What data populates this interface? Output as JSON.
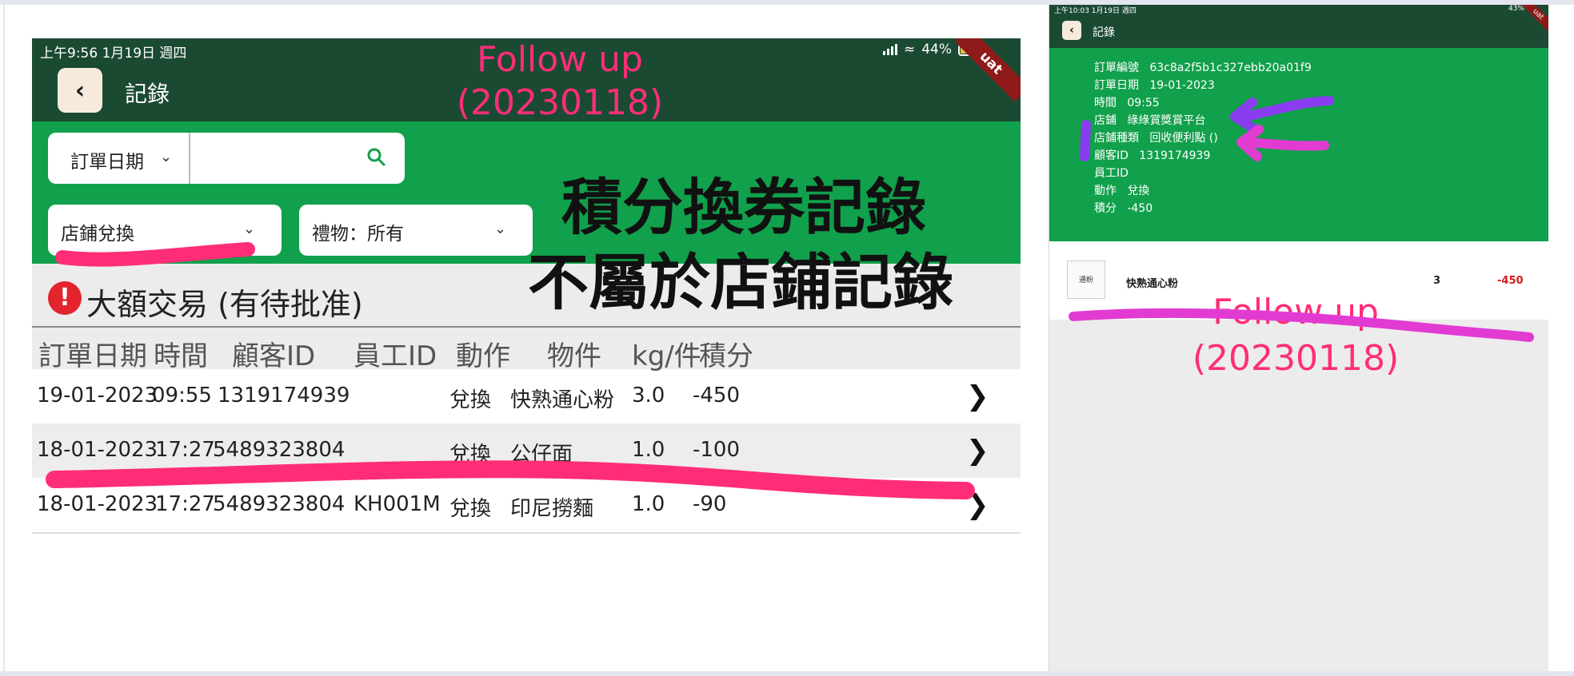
{
  "colors": {
    "header": "#1b4a33",
    "primary_green": "#11a04b",
    "annotation_pink": "#ff2d78",
    "annotation_purple": "#8a3cf0",
    "points_negative": "#d21a1a"
  },
  "left": {
    "status": {
      "time_date": "上午9:56   1月19日 週四",
      "battery": "44%"
    },
    "header": {
      "title": "記錄",
      "back_icon": "chevron-left-icon",
      "ribbon": "uat"
    },
    "search": {
      "select_label": "訂單日期",
      "value": "",
      "placeholder": ""
    },
    "filters": {
      "store_type": "店鋪兌換",
      "gift": "禮物：所有"
    },
    "big_transactions": "大額交易 (有待批准)",
    "table": {
      "headers": [
        "訂單日期",
        "時間",
        "顧客ID",
        "員工ID",
        "動作",
        "物件",
        "kg/件",
        "積分"
      ],
      "rows": [
        [
          "19-01-2023",
          "09:55",
          "1319174939",
          "",
          "兌換",
          "快熟通心粉",
          "3.0",
          "-450"
        ],
        [
          "18-01-2023",
          "17:27",
          "5489323804",
          "",
          "兌換",
          "公仔面",
          "1.0",
          "-100"
        ],
        [
          "18-01-2023",
          "17:27",
          "5489323804",
          "KH001M",
          "兌換",
          "印尼撈麵",
          "1.0",
          "-90"
        ]
      ]
    }
  },
  "annotations": {
    "follow_up": "Follow up",
    "follow_up_date": "(20230118)",
    "note_line1": "積分換券記錄",
    "note_line2": "不屬於店鋪記錄"
  },
  "right": {
    "status": {
      "time_date": "上午10:03  1月19日 週四",
      "battery": "43%"
    },
    "header": {
      "title": "記錄",
      "ribbon": "uat"
    },
    "details": [
      {
        "label": "訂單編號",
        "value": "63c8a2f5b1c327ebb20a01f9"
      },
      {
        "label": "訂單日期",
        "value": "19-01-2023"
      },
      {
        "label": "時間",
        "value": "09:55"
      },
      {
        "label": "店鋪",
        "value": "綠綠賞獎賞平台"
      },
      {
        "label": "店鋪種類",
        "value": "回收便利點 ()"
      },
      {
        "label": "顧客ID",
        "value": "1319174939"
      },
      {
        "label": "員工ID",
        "value": ""
      },
      {
        "label": "動作",
        "value": "兌換"
      },
      {
        "label": "積分",
        "value": "-450"
      }
    ],
    "item": {
      "thumb_text": "通粉",
      "name": "快熟通心粉",
      "qty": "3",
      "points": "-450"
    }
  }
}
